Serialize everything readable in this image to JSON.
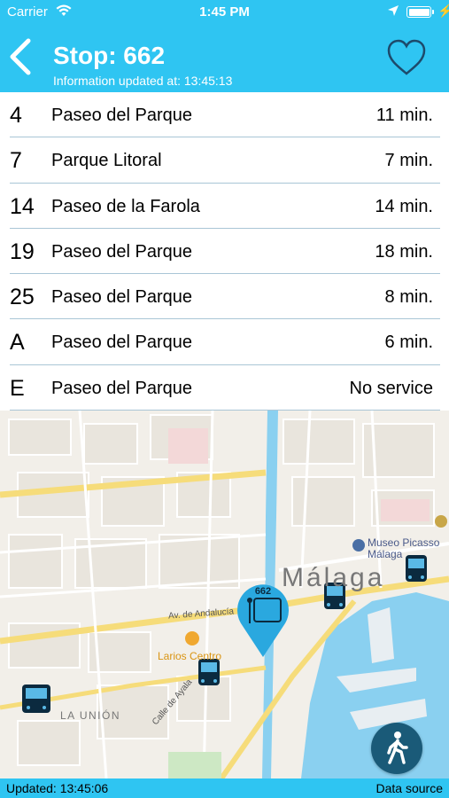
{
  "status_bar": {
    "carrier": "Carrier",
    "time": "1:45 PM"
  },
  "header": {
    "title": "Stop: 662",
    "subtitle": "Information updated at: 13:45:13"
  },
  "arrivals": [
    {
      "line": "4",
      "destination": "Paseo del Parque",
      "eta": "11 min."
    },
    {
      "line": "7",
      "destination": "Parque Litoral",
      "eta": "7 min."
    },
    {
      "line": "14",
      "destination": "Paseo de la Farola",
      "eta": "14 min."
    },
    {
      "line": "19",
      "destination": "Paseo del Parque",
      "eta": "18 min."
    },
    {
      "line": "25",
      "destination": "Paseo del Parque",
      "eta": "8 min."
    },
    {
      "line": "A",
      "destination": "Paseo del Parque",
      "eta": "6 min."
    },
    {
      "line": "E",
      "destination": "Paseo del Parque",
      "eta": "No service"
    }
  ],
  "map": {
    "city": "Málaga",
    "poi_museum_line1": "Museo Picasso",
    "poi_museum_line2": "Málaga",
    "poi_mall": "Larios Centro",
    "street_andalucia": "Av. de Andalucía",
    "district_union": "LA UNIÓN",
    "street_ayala": "Calle de Ayala",
    "stop_marker_number": "662"
  },
  "footer": {
    "updated": "Updated: 13:45:06",
    "data_source": "Data source"
  },
  "colors": {
    "header_bg": "#2fc5f2",
    "marker": "#2aa8df",
    "walk_button": "#1a5a78"
  }
}
